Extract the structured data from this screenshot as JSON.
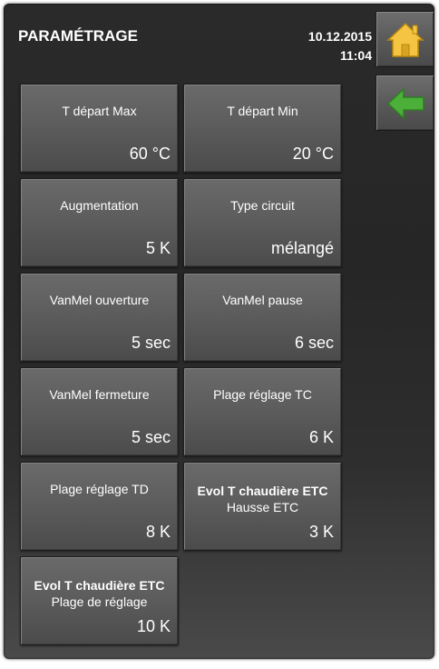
{
  "header": {
    "title": "PARAMÉTRAGE",
    "date": "10.12.2015",
    "time": "11:04"
  },
  "nav": {
    "home_icon": "home-icon",
    "back_icon": "back-arrow-icon",
    "home_color": "#f5c542",
    "back_color": "#4caf3a"
  },
  "tiles": [
    {
      "label": "T départ Max",
      "value": "60 °C"
    },
    {
      "label": "T départ Min",
      "value": "20 °C"
    },
    {
      "label": "Augmentation",
      "value": "5 K"
    },
    {
      "label": "Type circuit",
      "value": "mélangé"
    },
    {
      "label": "VanMel ouverture",
      "value": "5 sec"
    },
    {
      "label": "VanMel pause",
      "value": "6 sec"
    },
    {
      "label": "VanMel fermeture",
      "value": "5 sec"
    },
    {
      "label": "Plage réglage TC",
      "value": "6 K"
    },
    {
      "label": "Plage réglage TD",
      "value": "8 K"
    },
    {
      "label_bold": "Evol T chaudière ETC",
      "label": "Hausse ETC",
      "value": "3 K"
    },
    {
      "label_bold": "Evol T chaudière ETC",
      "label": "Plage de réglage",
      "value": "10 K"
    }
  ]
}
